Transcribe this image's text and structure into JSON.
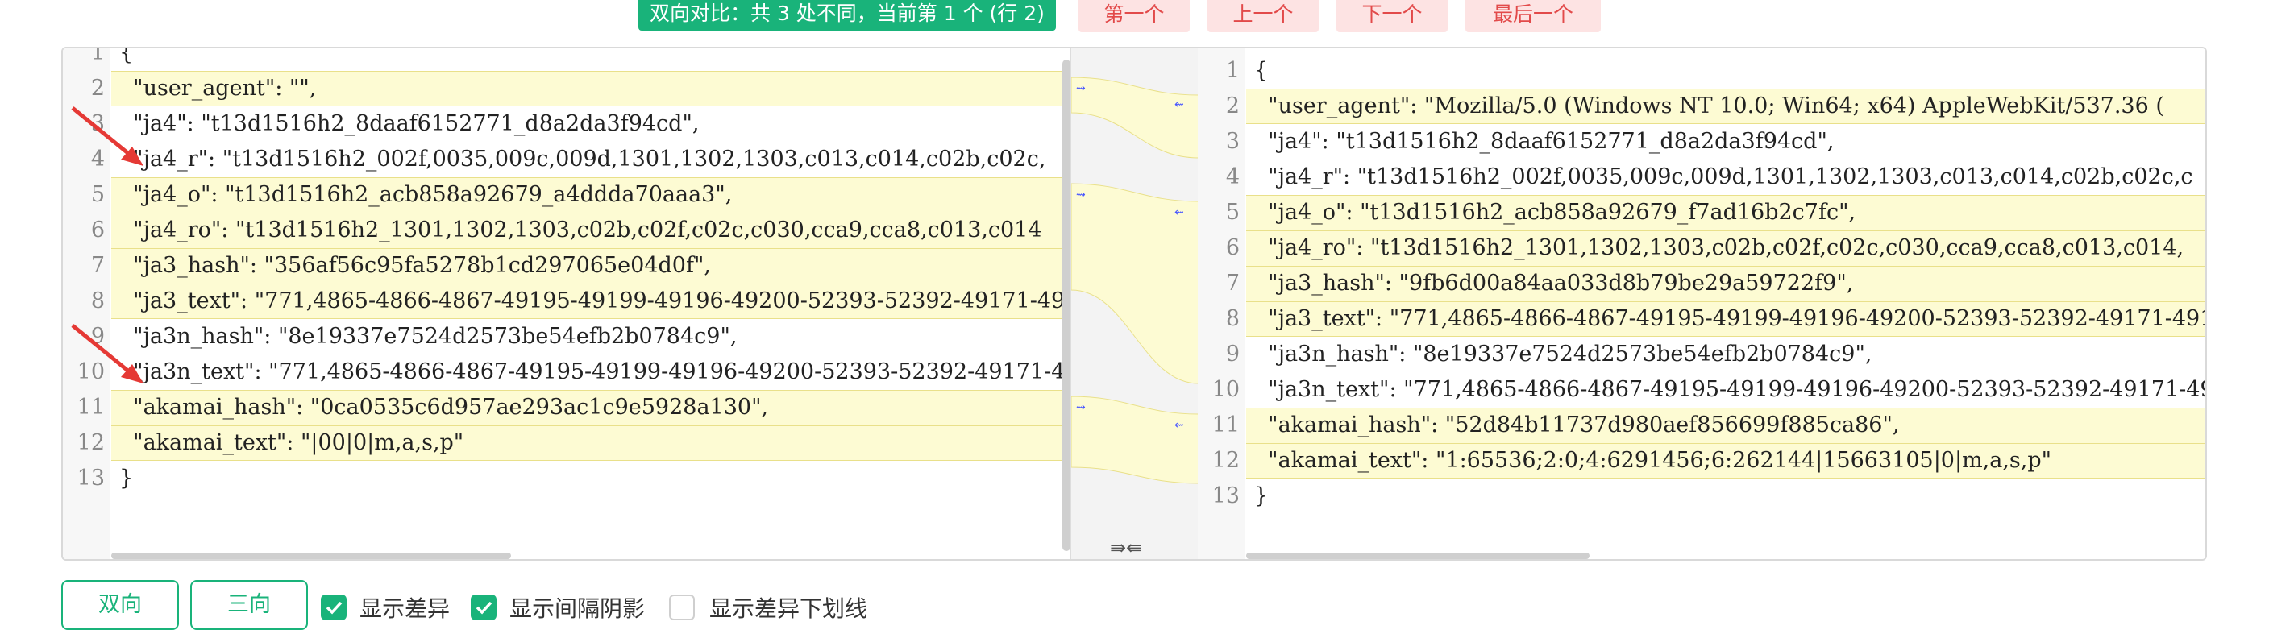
{
  "header": {
    "status_text": "双向对比：共 3 处不同，当前第 1 个 (行 2)",
    "buttons": [
      "第一个",
      "上一个",
      "下一个",
      "最后一个"
    ]
  },
  "left_pane": {
    "lines": [
      {
        "n": "1",
        "text": "{"
      },
      {
        "n": "2",
        "text": "  \"user_agent\": \"\","
      },
      {
        "n": "3",
        "text": "  \"ja4\": \"t13d1516h2_8daaf6152771_d8a2da3f94cd\","
      },
      {
        "n": "4",
        "text": "  \"ja4_r\": \"t13d1516h2_002f,0035,009c,009d,1301,1302,1303,c013,c014,c02b,c02c,"
      },
      {
        "n": "5",
        "text": "  \"ja4_o\": \"t13d1516h2_acb858a92679_a4ddda70aaa3\","
      },
      {
        "n": "6",
        "text": "  \"ja4_ro\": \"t13d1516h2_1301,1302,1303,c02b,c02f,c02c,c030,cca9,cca8,c013,c014"
      },
      {
        "n": "7",
        "text": "  \"ja3_hash\": \"356af56c95fa5278b1cd297065e04d0f\","
      },
      {
        "n": "8",
        "text": "  \"ja3_text\": \"771,4865-4866-4867-49195-49199-49196-49200-52393-52392-49171-49"
      },
      {
        "n": "9",
        "text": "  \"ja3n_hash\": \"8e19337e7524d2573be54efb2b0784c9\","
      },
      {
        "n": "10",
        "text": "  \"ja3n_text\": \"771,4865-4866-4867-49195-49199-49196-49200-52393-52392-49171-4"
      },
      {
        "n": "11",
        "text": "  \"akamai_hash\": \"0ca0535c6d957ae293ac1c9e5928a130\","
      },
      {
        "n": "12",
        "text": "  \"akamai_text\": \"|00|0|m,a,s,p\""
      },
      {
        "n": "13",
        "text": "}"
      }
    ]
  },
  "right_pane": {
    "lines": [
      {
        "n": "1",
        "text": "{"
      },
      {
        "n": "2",
        "text": "  \"user_agent\": \"Mozilla/5.0 (Windows NT 10.0; Win64; x64) AppleWebKit/537.36 ("
      },
      {
        "n": "3",
        "text": "  \"ja4\": \"t13d1516h2_8daaf6152771_d8a2da3f94cd\","
      },
      {
        "n": "4",
        "text": "  \"ja4_r\": \"t13d1516h2_002f,0035,009c,009d,1301,1302,1303,c013,c014,c02b,c02c,c"
      },
      {
        "n": "5",
        "text": "  \"ja4_o\": \"t13d1516h2_acb858a92679_f7ad16b2c7fc\","
      },
      {
        "n": "6",
        "text": "  \"ja4_ro\": \"t13d1516h2_1301,1302,1303,c02b,c02f,c02c,c030,cca9,cca8,c013,c014,"
      },
      {
        "n": "7",
        "text": "  \"ja3_hash\": \"9fb6d00a84aa033d8b79be29a59722f9\","
      },
      {
        "n": "8",
        "text": "  \"ja3_text\": \"771,4865-4866-4867-49195-49199-49196-49200-52393-52392-49171-491"
      },
      {
        "n": "9",
        "text": "  \"ja3n_hash\": \"8e19337e7524d2573be54efb2b0784c9\","
      },
      {
        "n": "10",
        "text": "  \"ja3n_text\": \"771,4865-4866-4867-49195-49199-49196-49200-52393-52392-49171-49"
      },
      {
        "n": "11",
        "text": "  \"akamai_hash\": \"52d84b11737d980aef856699f885ca86\","
      },
      {
        "n": "12",
        "text": "  \"akamai_text\": \"1:65536;2:0;4:6291456;6:262144|15663105|0|m,a,s,p\""
      },
      {
        "n": "13",
        "text": "}"
      }
    ]
  },
  "center": {
    "swap_label": "⇛⇚",
    "merge_left_icon": "merge-right-icon",
    "merge_right_icon": "merge-left-icon"
  },
  "footer": {
    "mode_buttons": [
      "双向",
      "三向"
    ],
    "options": [
      {
        "label": "显示差异",
        "checked": true
      },
      {
        "label": "显示间隔阴影",
        "checked": true
      },
      {
        "label": "显示差异下划线",
        "checked": false
      }
    ]
  },
  "colors": {
    "accent": "#19b37a",
    "nav_bg": "#fde3e3",
    "nav_text": "#e24a4a",
    "diff_bg": "#fdfbd3",
    "annotation_arrow": "#e53935"
  }
}
